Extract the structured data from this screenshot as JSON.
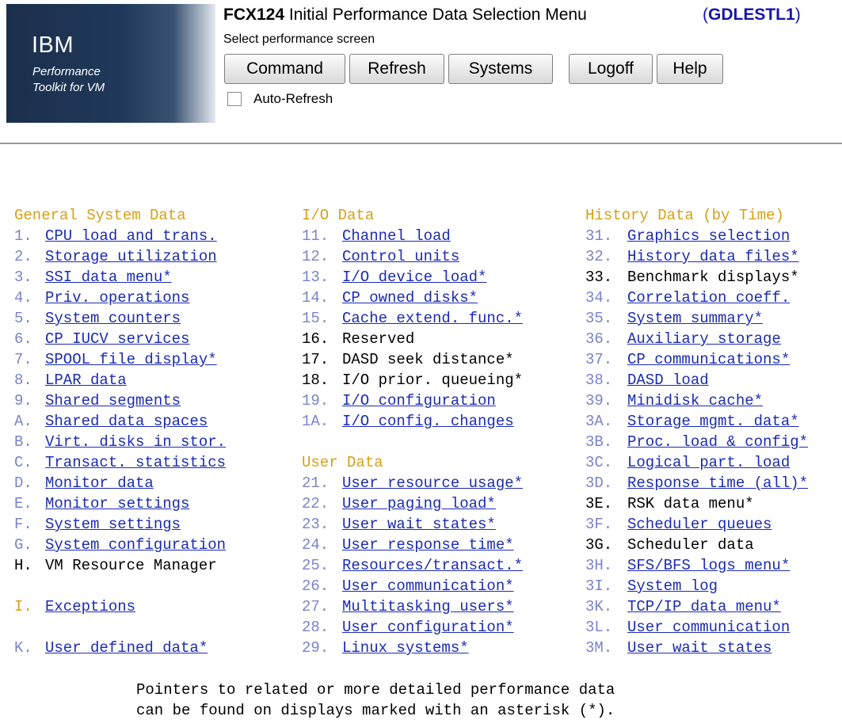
{
  "header": {
    "logo_ibm": "IBM",
    "logo_line1": "Performance",
    "logo_line2": "Toolkit for VM",
    "title_code": "FCX124",
    "title_text": "Initial Performance Data Selection Menu",
    "system_id": "GDLESTL1",
    "subtitle": "Select performance screen",
    "buttons": [
      "Command",
      "Refresh",
      "Systems",
      "Logoff",
      "Help"
    ],
    "auto_refresh_label": "Auto-Refresh",
    "auto_refresh_checked": false
  },
  "colors": {
    "heading": "#d4a017",
    "link": "#1b2bb3",
    "number": "#7b84c6",
    "system_id": "#1515b0"
  },
  "columns": [
    {
      "sections": [
        {
          "heading": "General System Data",
          "items": [
            {
              "num": "1.",
              "label": "CPU load and trans.",
              "link": true
            },
            {
              "num": "2.",
              "label": "Storage utilization",
              "link": true
            },
            {
              "num": "3.",
              "label": "SSI data menu*",
              "link": true
            },
            {
              "num": "4.",
              "label": "Priv. operations",
              "link": true
            },
            {
              "num": "5.",
              "label": "System counters",
              "link": true
            },
            {
              "num": "6.",
              "label": "CP IUCV services",
              "link": true
            },
            {
              "num": "7.",
              "label": "SPOOL file display*",
              "link": true
            },
            {
              "num": "8.",
              "label": "LPAR data",
              "link": true
            },
            {
              "num": "9.",
              "label": "Shared segments",
              "link": true
            },
            {
              "num": "A.",
              "label": "Shared data spaces",
              "link": true
            },
            {
              "num": "B.",
              "label": "Virt. disks in stor.",
              "link": true
            },
            {
              "num": "C.",
              "label": "Transact. statistics",
              "link": true
            },
            {
              "num": "D.",
              "label": "Monitor data",
              "link": true
            },
            {
              "num": "E.",
              "label": "Monitor settings",
              "link": true
            },
            {
              "num": "F.",
              "label": "System settings",
              "link": true
            },
            {
              "num": "G.",
              "label": "System configuration",
              "link": true
            },
            {
              "num": "H.",
              "label": "VM Resource Manager",
              "link": false
            },
            {
              "num": "",
              "label": "",
              "link": false
            },
            {
              "num": "I.",
              "label": "Exceptions",
              "link": true,
              "gold_num": true
            },
            {
              "num": "",
              "label": "",
              "link": false
            },
            {
              "num": "K.",
              "label": "User defined data*",
              "link": true
            }
          ]
        }
      ]
    },
    {
      "sections": [
        {
          "heading": "I/O Data",
          "items": [
            {
              "num": "11.",
              "label": "Channel load",
              "link": true
            },
            {
              "num": "12.",
              "label": "Control units",
              "link": true
            },
            {
              "num": "13.",
              "label": "I/O device load*",
              "link": true
            },
            {
              "num": "14.",
              "label": "CP owned disks*",
              "link": true
            },
            {
              "num": "15.",
              "label": "Cache extend. func.*",
              "link": true
            },
            {
              "num": "16.",
              "label": "Reserved",
              "link": false
            },
            {
              "num": "17.",
              "label": "DASD seek distance*",
              "link": false
            },
            {
              "num": "18.",
              "label": "I/O prior. queueing*",
              "link": false
            },
            {
              "num": "19.",
              "label": "I/O configuration",
              "link": true
            },
            {
              "num": "1A.",
              "label": "I/O config. changes",
              "link": true
            }
          ]
        },
        {
          "heading": "User Data",
          "items": [
            {
              "num": "21.",
              "label": "User resource usage*",
              "link": true
            },
            {
              "num": "22.",
              "label": "User paging load*",
              "link": true
            },
            {
              "num": "23.",
              "label": "User wait states*",
              "link": true
            },
            {
              "num": "24.",
              "label": "User response time*",
              "link": true
            },
            {
              "num": "25.",
              "label": "Resources/transact.*",
              "link": true
            },
            {
              "num": "26.",
              "label": "User communication*",
              "link": true
            },
            {
              "num": "27.",
              "label": "Multitasking users*",
              "link": true
            },
            {
              "num": "28.",
              "label": "User configuration*",
              "link": true
            },
            {
              "num": "29.",
              "label": "Linux systems*",
              "link": true
            }
          ]
        }
      ]
    },
    {
      "sections": [
        {
          "heading": "History Data (by Time)",
          "items": [
            {
              "num": "31.",
              "label": "Graphics selection",
              "link": true
            },
            {
              "num": "32.",
              "label": "History data files*",
              "link": true
            },
            {
              "num": "33.",
              "label": "Benchmark displays*",
              "link": false
            },
            {
              "num": "34.",
              "label": "Correlation coeff.",
              "link": true
            },
            {
              "num": "35.",
              "label": "System summary*",
              "link": true
            },
            {
              "num": "36.",
              "label": "Auxiliary storage",
              "link": true
            },
            {
              "num": "37.",
              "label": "CP communications*",
              "link": true
            },
            {
              "num": "38.",
              "label": "DASD load",
              "link": true
            },
            {
              "num": "39.",
              "label": "Minidisk cache*",
              "link": true
            },
            {
              "num": "3A.",
              "label": "Storage mgmt. data*",
              "link": true
            },
            {
              "num": "3B.",
              "label": "Proc. load & config*",
              "link": true
            },
            {
              "num": "3C.",
              "label": "Logical part. load",
              "link": true
            },
            {
              "num": "3D.",
              "label": "Response time (all)*",
              "link": true
            },
            {
              "num": "3E.",
              "label": "RSK data menu*",
              "link": false
            },
            {
              "num": "3F.",
              "label": "Scheduler queues",
              "link": true
            },
            {
              "num": "3G.",
              "label": "Scheduler data",
              "link": false
            },
            {
              "num": "3H.",
              "label": "SFS/BFS logs menu*",
              "link": true
            },
            {
              "num": "3I.",
              "label": "System log",
              "link": true
            },
            {
              "num": "3K.",
              "label": "TCP/IP data menu*",
              "link": true
            },
            {
              "num": "3L.",
              "label": "User communication",
              "link": true
            },
            {
              "num": "3M.",
              "label": "User wait states",
              "link": true
            }
          ]
        }
      ]
    }
  ],
  "footer": {
    "line1": "Pointers to related or more detailed performance data",
    "line2": "can be found on displays marked with an asterisk (*)."
  }
}
